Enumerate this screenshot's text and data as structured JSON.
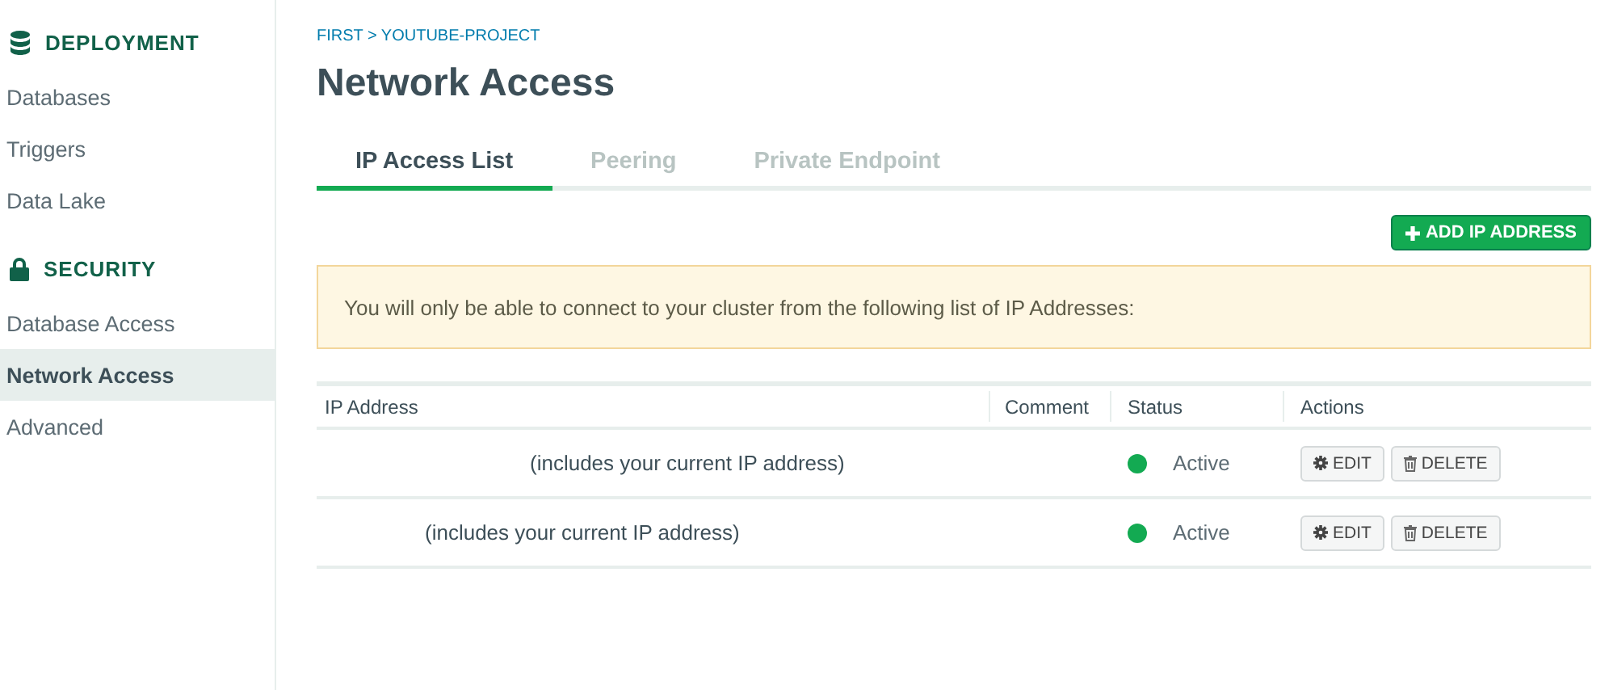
{
  "sidebar": {
    "sections": [
      {
        "title": "DEPLOYMENT",
        "items": [
          {
            "label": "Databases",
            "selected": false
          },
          {
            "label": "Triggers",
            "selected": false
          },
          {
            "label": "Data Lake",
            "selected": false
          }
        ]
      },
      {
        "title": "SECURITY",
        "items": [
          {
            "label": "Database Access",
            "selected": false
          },
          {
            "label": "Network Access",
            "selected": true
          },
          {
            "label": "Advanced",
            "selected": false
          }
        ]
      }
    ]
  },
  "breadcrumb": "FIRST > YOUTUBE-PROJECT",
  "title": "Network Access",
  "tabs": [
    {
      "label": "IP Access List",
      "selected": true
    },
    {
      "label": "Peering",
      "selected": false
    },
    {
      "label": "Private Endpoint",
      "selected": false
    }
  ],
  "add_button": "ADD IP ADDRESS",
  "notice": "You will only be able to connect to your cluster from the following list of IP Addresses:",
  "table": {
    "columns": [
      "IP Address",
      "Comment",
      "Status",
      "Actions"
    ],
    "rows": [
      {
        "ip_address": "(includes your current IP address)",
        "status": "Active",
        "edit": "EDIT",
        "delete": "DELETE"
      },
      {
        "ip_address": "(includes your current IP address)",
        "status": "Active",
        "edit": "EDIT",
        "delete": "DELETE"
      }
    ]
  }
}
